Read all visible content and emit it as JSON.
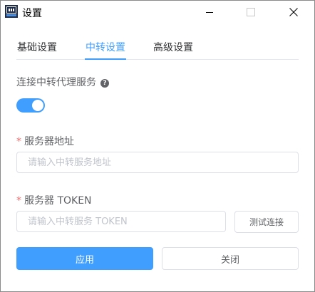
{
  "window": {
    "title": "设置",
    "icon": "app-icon",
    "controls": {
      "minimize": "minimize-icon",
      "maximize": "maximize-icon",
      "close": "close-icon"
    }
  },
  "tabs": [
    {
      "label": "基础设置",
      "active": false
    },
    {
      "label": "中转设置",
      "active": true
    },
    {
      "label": "高级设置",
      "active": false
    }
  ],
  "form": {
    "relay_toggle_label": "连接中转代理服务",
    "relay_toggle_on": true,
    "help_icon": "?",
    "required_mark": "*",
    "server_address_label": "服务器地址",
    "server_address_value": "",
    "server_address_placeholder": "请输入中转服务地址",
    "server_token_label": "服务器 TOKEN",
    "server_token_value": "",
    "server_token_placeholder": "请输入中转服务 TOKEN",
    "test_button": "测试连接"
  },
  "actions": {
    "apply": "应用",
    "close": "关闭"
  },
  "colors": {
    "accent": "#409eff",
    "required": "#f56c6c",
    "border": "#dcdfe6",
    "text": "#606266",
    "placeholder": "#c0c4cc"
  }
}
